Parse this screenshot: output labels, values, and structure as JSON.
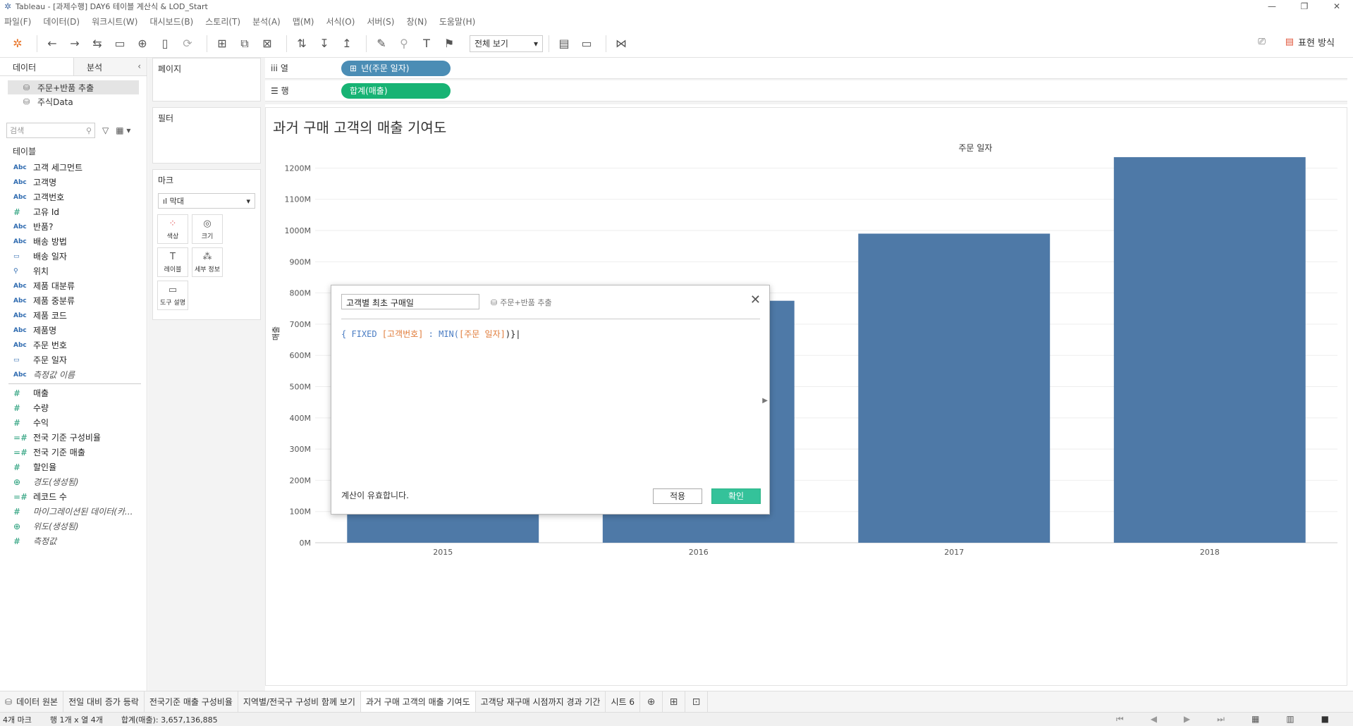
{
  "window": {
    "title": "Tableau - [과제수행] DAY6 테이블 계산식 & LOD_Start",
    "controls": [
      "—",
      "❐",
      "✕"
    ]
  },
  "menu": [
    "파일(F)",
    "데이터(D)",
    "워크시트(W)",
    "대시보드(B)",
    "스토리(T)",
    "분석(A)",
    "맵(M)",
    "서식(O)",
    "서버(S)",
    "창(N)",
    "도움말(H)"
  ],
  "toolbar": {
    "view_select": "전체 보기",
    "show_me": "표현 방식"
  },
  "datapane": {
    "tabs": [
      "데이터",
      "분석"
    ],
    "sources": [
      {
        "icon": "extract-icon",
        "label": "주문+반품 추출"
      },
      {
        "icon": "datasource-icon",
        "label": "주식Data"
      }
    ],
    "search_placeholder": "검색",
    "tables_label": "테이블",
    "dimensions": [
      {
        "type": "Abc",
        "label": "고객 세그먼트"
      },
      {
        "type": "Abc",
        "label": "고객명"
      },
      {
        "type": "Abc",
        "label": "고객번호"
      },
      {
        "type": "#",
        "label": "고유 Id"
      },
      {
        "type": "Abc",
        "label": "반품?"
      },
      {
        "type": "Abc",
        "label": "배송 방법"
      },
      {
        "type": "cal",
        "label": "배송 일자"
      },
      {
        "type": "geo",
        "label": "위치"
      },
      {
        "type": "Abc",
        "label": "제품 대분류"
      },
      {
        "type": "Abc",
        "label": "제품 중분류"
      },
      {
        "type": "Abc",
        "label": "제품 코드"
      },
      {
        "type": "Abc",
        "label": "제품명"
      },
      {
        "type": "Abc",
        "label": "주문 번호"
      },
      {
        "type": "cal",
        "label": "주문 일자"
      },
      {
        "type": "Abc",
        "label": "측정값 이름"
      }
    ],
    "measures": [
      {
        "type": "#",
        "label": "매출"
      },
      {
        "type": "#",
        "label": "수량"
      },
      {
        "type": "#",
        "label": "수익"
      },
      {
        "type": "=#",
        "label": "전국 기준 구성비율"
      },
      {
        "type": "=#",
        "label": "전국 기준 매출"
      },
      {
        "type": "#",
        "label": "할인율"
      },
      {
        "type": "globe",
        "label": "경도(생성됨)"
      },
      {
        "type": "=#",
        "label": "레코드 수"
      },
      {
        "type": "#",
        "label": "마이그레이션된 데이터(카..."
      },
      {
        "type": "globe",
        "label": "위도(생성됨)"
      },
      {
        "type": "#",
        "label": "측정값"
      }
    ]
  },
  "cards": {
    "pages": "페이지",
    "filters": "필터",
    "marks": "마크",
    "mark_type": "막대",
    "mark_buttons": [
      {
        "icon": "color-icon",
        "label": "색상"
      },
      {
        "icon": "size-icon",
        "label": "크기"
      },
      {
        "icon": "label-icon",
        "label": "레이블"
      },
      {
        "icon": "detail-icon",
        "label": "세부 정보"
      },
      {
        "icon": "tooltip-icon",
        "label": "도구 설명"
      }
    ]
  },
  "shelves": {
    "columns_label": "열",
    "rows_label": "행",
    "columns_pill": "년(주문 일자)",
    "rows_pill": "합계(매출)"
  },
  "viz": {
    "title": "과거 구매 고객의 매출 기여도",
    "header": "주문 일자",
    "bar_color": "#4e79a7"
  },
  "chart_data": {
    "type": "bar",
    "title": "과거 구매 고객의 매출 기여도",
    "xlabel": "주문 일자",
    "ylabel": "매출",
    "categories": [
      "2015",
      "2016",
      "2017",
      "2018"
    ],
    "values": [
      470,
      775,
      990,
      1235
    ],
    "ylim": [
      0,
      1280
    ],
    "yticks": [
      0,
      100,
      200,
      300,
      400,
      500,
      600,
      700,
      800,
      900,
      1000,
      1100,
      1200
    ],
    "ytick_labels": [
      "0M",
      "100M",
      "200M",
      "300M",
      "400M",
      "500M",
      "600M",
      "700M",
      "800M",
      "900M",
      "1000M",
      "1100M",
      "1200M"
    ],
    "grid": true
  },
  "calc_dialog": {
    "name": "고객별 최초 구매일",
    "source": "주문+반품 추출",
    "code_open": "{ FIXED ",
    "code_field1": "[고객번호]",
    "code_mid": " : MIN(",
    "code_field2": "[주문 일자]",
    "code_close": ")}",
    "status": "계산이 유효합니다.",
    "apply": "적용",
    "ok": "확인"
  },
  "tabs": [
    {
      "label": "데이터 원본",
      "active": false,
      "icon": "datasource-tab-icon"
    },
    {
      "label": "전일 대비 증가 등락",
      "active": false
    },
    {
      "label": "전국기준 매출 구성비율",
      "active": false
    },
    {
      "label": "지역별/전국구 구성비 함께 보기",
      "active": false
    },
    {
      "label": "과거 구매 고객의 매출 기여도",
      "active": true
    },
    {
      "label": "고객당 재구매 시점까지 경과 기간",
      "active": false
    },
    {
      "label": "시트 6",
      "active": false
    }
  ],
  "status": {
    "marks": "4개 마크",
    "rows_cols": "행 1개 x 열 4개",
    "sum": "합계(매출): 3,657,136,885"
  }
}
